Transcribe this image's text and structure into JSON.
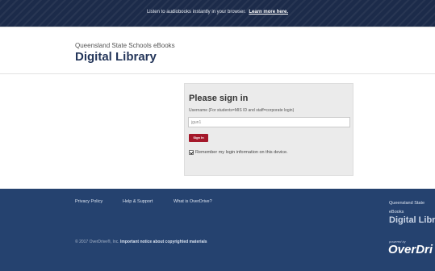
{
  "banner": {
    "message": "Listen to audiobooks instantly in your browser.",
    "link": "Learn more here."
  },
  "brand": {
    "subtitle": "Queensland State Schools eBooks",
    "title": "Digital Library"
  },
  "signin": {
    "heading": "Please sign in",
    "username_label": "Username (For students=MIS ID and staff=corporate login)",
    "username_value": "jgun1",
    "button": "Sign In",
    "remember_label": "Remember my login information on this device.",
    "remember_checked": true
  },
  "footer": {
    "links": [
      "Privacy Policy",
      "Help & Support",
      "What is OverDrive?"
    ],
    "copyright": "© 2017 OverDrive®, Inc.",
    "notice": "Important notice about copyrighted materials",
    "brand_line1": "Queensland State",
    "brand_line2": "eBooks",
    "brand_title": "Digital Libr",
    "powered_by": "powered by",
    "overdrive": "OverDri"
  }
}
